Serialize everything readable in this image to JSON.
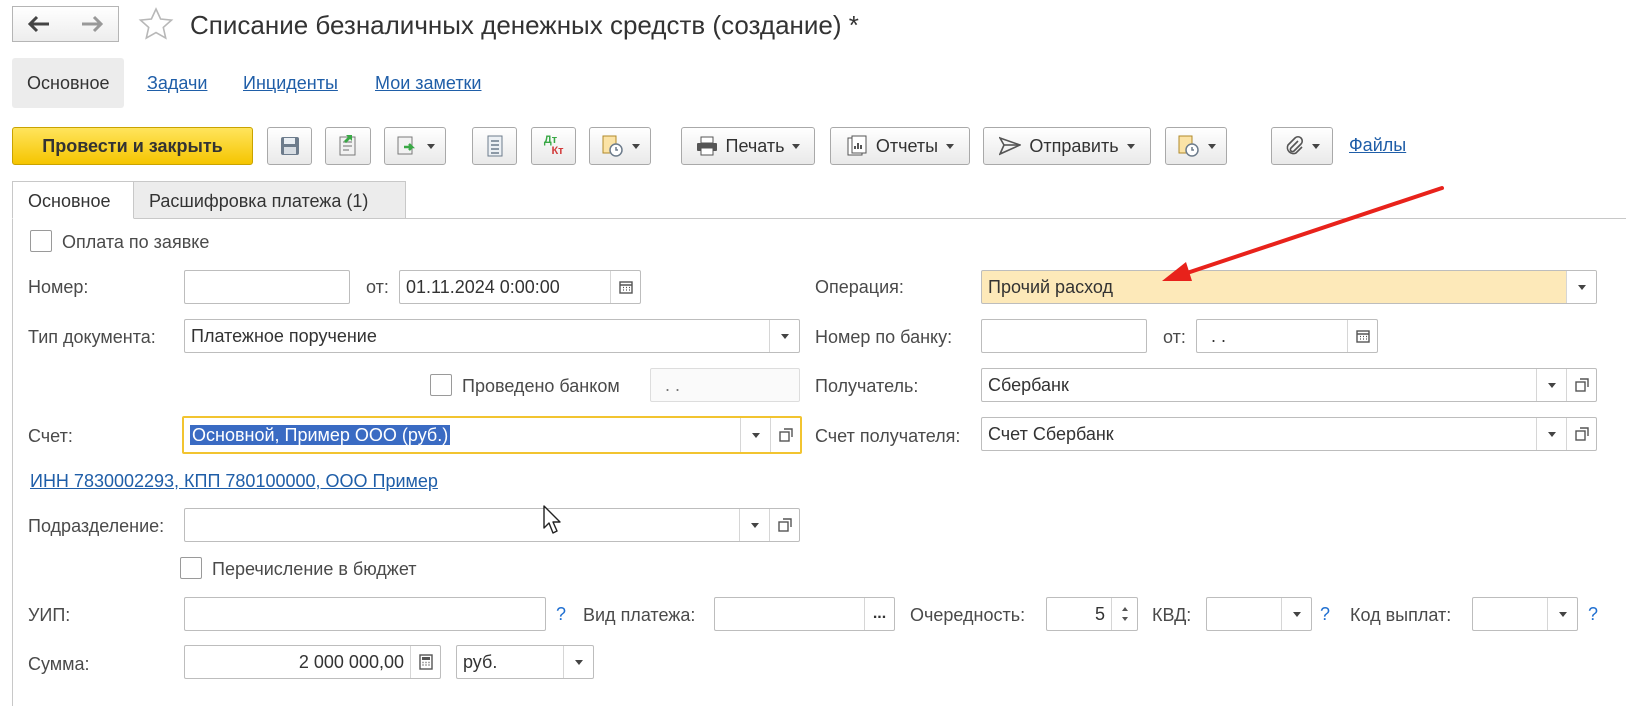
{
  "header": {
    "title": "Списание безналичных денежных средств (создание) *"
  },
  "subtabs": [
    {
      "label": "Основное"
    },
    {
      "label": "Задачи"
    },
    {
      "label": "Инциденты"
    },
    {
      "label": "Мои заметки"
    }
  ],
  "toolbar": {
    "post_close": "Провести и закрыть",
    "print": "Печать",
    "reports": "Отчеты",
    "send": "Отправить",
    "files": "Файлы",
    "dt": "Дт",
    "kt": "Кт"
  },
  "tabs": [
    {
      "label": "Основное"
    },
    {
      "label": "Расшифровка платежа (1)"
    }
  ],
  "form": {
    "pay_by_request": "Оплата по заявке",
    "number_label": "Номер:",
    "number_value": "",
    "from_label": "от:",
    "date_value": "01.11.2024  0:00:00",
    "doc_type_label": "Тип документа:",
    "doc_type_value": "Платежное поручение",
    "bank_done_label": "Проведено банком",
    "bank_done_date": " .  .",
    "account_label": "Счет:",
    "account_value": "Основной, Пример ООО (руб.)",
    "inn_link": "ИНН 7830002293, КПП 780100000, ООО Пример",
    "division_label": "Подразделение:",
    "division_value": "",
    "budget_label": "Перечисление в бюджет",
    "uip_label": "УИП:",
    "uip_value": "",
    "q": "?",
    "pay_kind_label": "Вид платежа:",
    "pay_kind_value": "",
    "ellipsis": "...",
    "priority_label": "Очередность:",
    "priority_value": "5",
    "kvd_label": "КВД:",
    "kvd_value": "",
    "pay_code_label": "Код выплат:",
    "pay_code_value": "",
    "sum_label": "Сумма:",
    "sum_value": "2 000 000,00",
    "currency_value": "руб.",
    "operation_label": "Операция:",
    "operation_value": "Прочий расход",
    "bank_number_label": "Номер по банку:",
    "bank_number_value": "",
    "bank_from_label": "от:",
    "bank_from_value": " .  .",
    "recipient_label": "Получатель:",
    "recipient_value": "Сбербанк",
    "recipient_account_label": "Счет получателя:",
    "recipient_account_value": "Счет Сбербанк"
  },
  "colors": {
    "primary_button": "#f5c500",
    "operation_highlight": "#fde9b9",
    "link": "#1f5ea8",
    "selection": "#3a6bc3",
    "annotation_arrow": "#e8221b"
  }
}
